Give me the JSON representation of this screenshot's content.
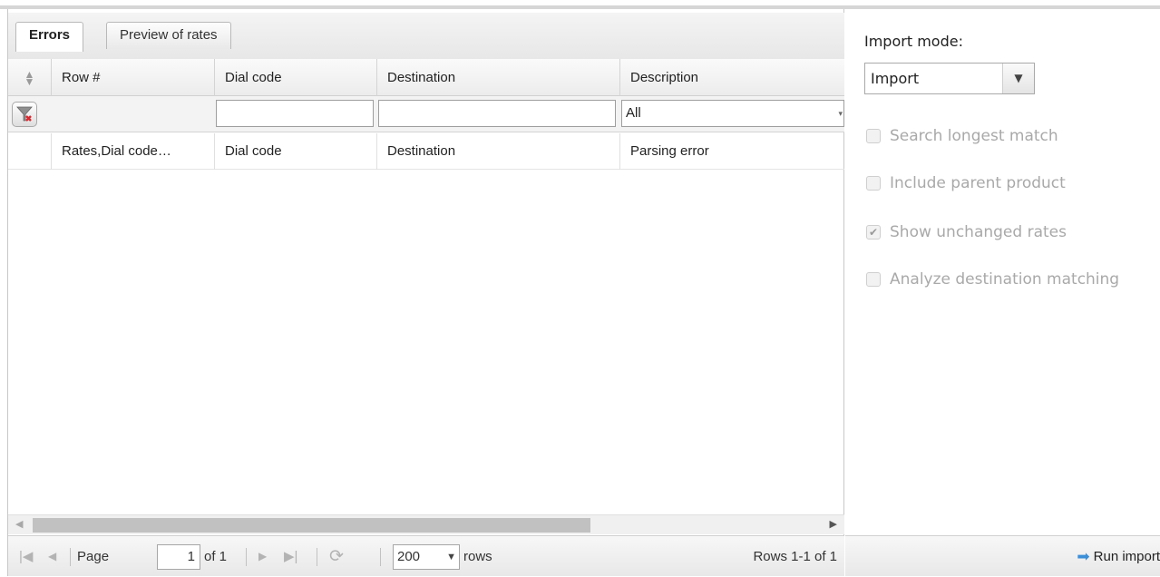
{
  "tabs": [
    {
      "label": "Errors",
      "active": true
    },
    {
      "label": "Preview of rates",
      "active": false
    }
  ],
  "grid": {
    "columns": [
      "Row #",
      "Dial code",
      "Destination",
      "Description"
    ],
    "filter": {
      "description_value": "All"
    },
    "rows": [
      {
        "row_num": "Rates,Dial code…",
        "dial_code": "Dial code",
        "destination": "Destination",
        "description": "Parsing error"
      }
    ]
  },
  "pager": {
    "page_label": "Page",
    "page_value": "1",
    "of_label": "of 1",
    "rows_per_page": "200",
    "rows_label": "rows",
    "summary": "Rows 1-1 of 1"
  },
  "import": {
    "label": "Import mode:",
    "mode": "Import",
    "options": [
      {
        "label": "Search longest match",
        "checked": false
      },
      {
        "label": "Include parent product",
        "checked": false
      },
      {
        "label": "Show unchanged rates",
        "checked": true
      },
      {
        "label": "Analyze destination matching",
        "checked": false
      }
    ],
    "run_label": "Run import"
  }
}
